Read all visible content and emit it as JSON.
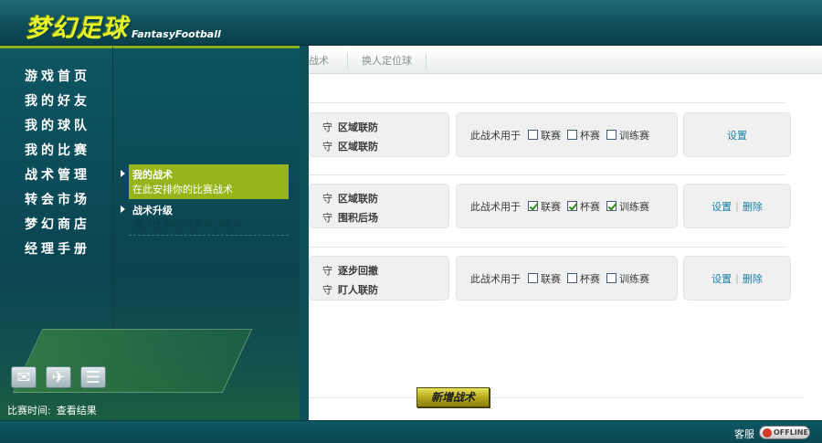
{
  "header": {
    "logo_cn": "梦幻足球",
    "logo_en": "FantasyFootball"
  },
  "nav": {
    "items": [
      {
        "label": "游戏首页"
      },
      {
        "label": "我的好友"
      },
      {
        "label": "我的球队"
      },
      {
        "label": "我的比赛"
      },
      {
        "label": "战术管理"
      },
      {
        "label": "转会市场"
      },
      {
        "label": "梦幻商店"
      },
      {
        "label": "经理手册"
      }
    ]
  },
  "submenu": {
    "items": [
      {
        "title": "我的战术",
        "desc": "在此安排你的比赛战术"
      },
      {
        "title": "战术升级",
        "desc": "通过比赛获得更多训练点"
      }
    ]
  },
  "tabs": [
    {
      "label": "战术"
    },
    {
      "label": "换人定位球"
    }
  ],
  "tactics": [
    {
      "lines": [
        {
          "g": "守",
          "v": "区域联防"
        },
        {
          "g": "守",
          "v": "区域联防"
        }
      ],
      "use_label": "此战术用于",
      "checks": [
        {
          "label": "联赛",
          "checked": false
        },
        {
          "label": "杯赛",
          "checked": false
        },
        {
          "label": "训练赛",
          "checked": false
        }
      ],
      "actions": [
        {
          "label": "设置"
        }
      ]
    },
    {
      "lines": [
        {
          "g": "守",
          "v": "区域联防"
        },
        {
          "g": "守",
          "v": "围积后场"
        }
      ],
      "use_label": "此战术用于",
      "checks": [
        {
          "label": "联赛",
          "checked": true
        },
        {
          "label": "杯赛",
          "checked": true
        },
        {
          "label": "训练赛",
          "checked": true
        }
      ],
      "actions": [
        {
          "label": "设置"
        },
        {
          "label": "删除"
        }
      ]
    },
    {
      "lines": [
        {
          "g": "守",
          "v": "逐步回撤"
        },
        {
          "g": "守",
          "v": "盯人联防"
        }
      ],
      "use_label": "此战术用于",
      "checks": [
        {
          "label": "联赛",
          "checked": false
        },
        {
          "label": "杯赛",
          "checked": false
        },
        {
          "label": "训练赛",
          "checked": false
        }
      ],
      "actions": [
        {
          "label": "设置"
        },
        {
          "label": "删除"
        }
      ]
    }
  ],
  "add_button": "新增战术",
  "match": {
    "label": "比赛时间:",
    "link": "查看结果"
  },
  "toolbar_icons": [
    "mail-icon",
    "plane-icon",
    "list-icon"
  ],
  "footer": {
    "kefu": "客服",
    "status": "OFFLINE"
  }
}
